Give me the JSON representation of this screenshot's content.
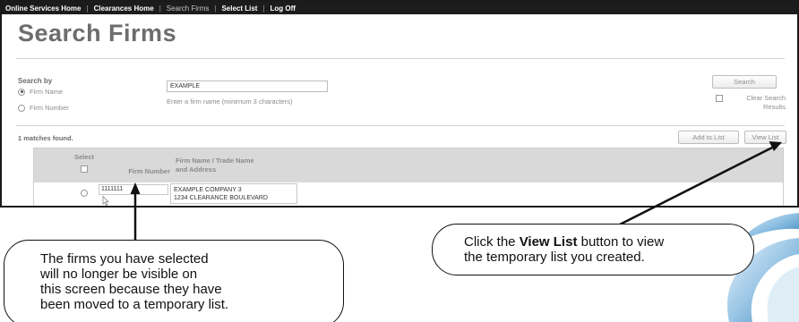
{
  "nav": {
    "items": [
      {
        "label": "Online Services Home",
        "dim": false
      },
      {
        "label": "Clearances Home",
        "dim": false
      },
      {
        "label": "Search Firms",
        "dim": true
      },
      {
        "label": "Select List",
        "dim": false
      },
      {
        "label": "Log Off",
        "dim": false
      }
    ]
  },
  "page_title": "Search Firms",
  "search_form": {
    "label": "Search by",
    "options": [
      {
        "label": "Firm Name",
        "checked": true
      },
      {
        "label": "Firm Number",
        "checked": false
      }
    ],
    "input_value": "EXAMPLE",
    "hint": "Enter a firm name (minimum 3 characters)",
    "search_button": "Search",
    "clear_label": "Clear Search Results"
  },
  "results": {
    "matches": "1 matches found.",
    "add_to_list": "Add to List",
    "view_list": "View List",
    "headers": {
      "select": "Select",
      "firm_number": "Firm Number",
      "firm_name_line1": "Firm Name / Trade Name",
      "firm_name_line2": "and Address"
    },
    "rows": [
      {
        "firm_number": "1111111",
        "name": "EXAMPLE COMPANY 3",
        "address": "1234 CLEARANCE BOULEVARD"
      }
    ]
  },
  "callouts": {
    "left_lines": [
      "The firms you have selected",
      "will no longer be visible on",
      "this screen because they have",
      "been moved to a temporary list."
    ],
    "right": {
      "prefix": "Click the ",
      "bold": "View List",
      "suffix_line1": " button to view",
      "line2": "the temporary list you created."
    }
  },
  "colors": {
    "nav_bg": "#1c1c1c",
    "header_bg": "#d9d9d9",
    "swoosh": "#2f7fb8"
  }
}
